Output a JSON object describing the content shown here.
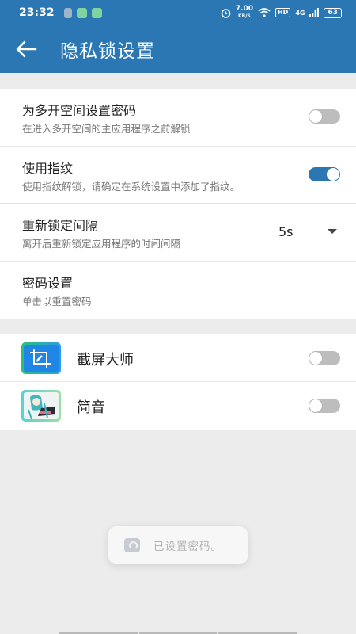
{
  "status_bar": {
    "time": "23:32",
    "net_speed": "7.00",
    "net_unit": "KB/S",
    "hd": "HD",
    "signal": "4G",
    "battery": "63"
  },
  "toolbar": {
    "title": "隐私锁设置"
  },
  "settings": [
    {
      "title": "为多开空间设置密码",
      "subtitle": "在进入多开空间的主应用程序之前解锁",
      "toggle": "off"
    },
    {
      "title": "使用指纹",
      "subtitle": "使用指纹解锁，请确定在系统设置中添加了指纹。",
      "toggle": "on"
    },
    {
      "title": "重新锁定间隔",
      "subtitle": "离开后重新锁定应用程序的时间间隔",
      "value": "5s"
    },
    {
      "title": "密码设置",
      "subtitle": "单击以重置密码"
    }
  ],
  "apps": [
    {
      "name": "截屏大师",
      "icon": "screenshot-app-icon",
      "toggle": "off"
    },
    {
      "name": "简音",
      "icon": "music-app-icon",
      "toggle": "off"
    }
  ],
  "toast": {
    "text": "已设置密码。"
  },
  "colors": {
    "primary": "#2a77b3",
    "background": "#ececec"
  }
}
